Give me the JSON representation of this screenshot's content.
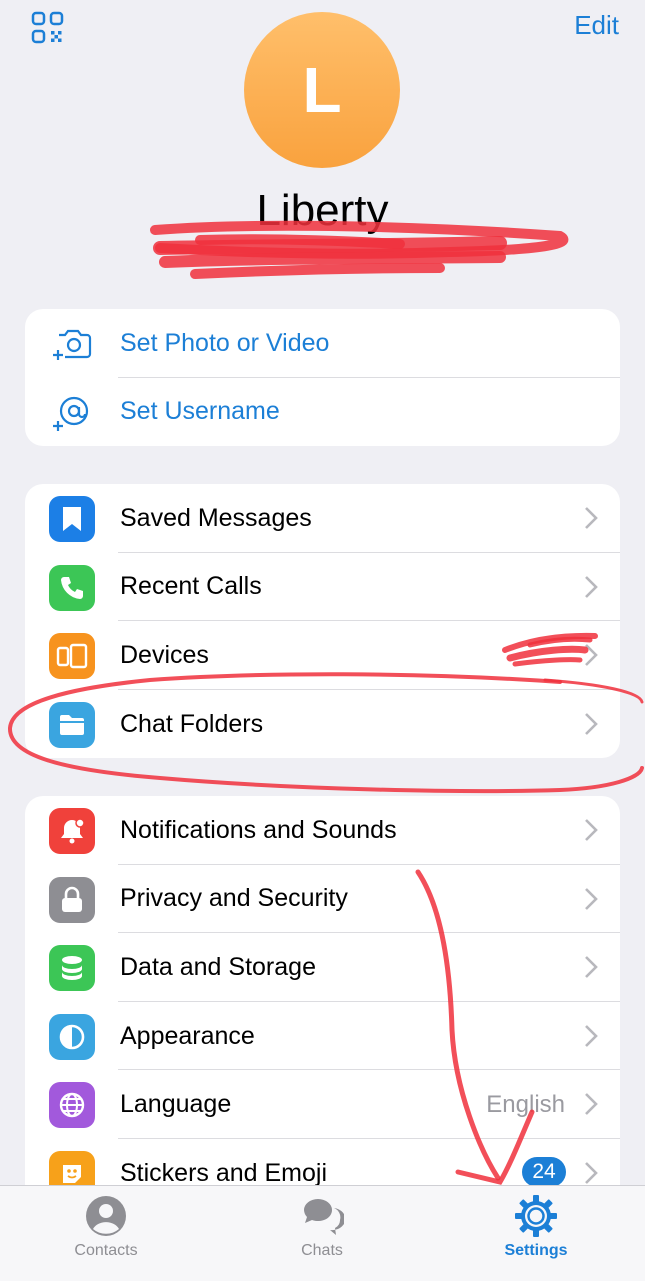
{
  "header": {
    "edit_label": "Edit",
    "qr_icon": "qr-code-icon"
  },
  "profile": {
    "initial": "L",
    "name": "Liberty",
    "avatar_color": "#f9a23e"
  },
  "account_actions": [
    {
      "label": "Set Photo or Video",
      "icon": "camera-add-icon"
    },
    {
      "label": "Set Username",
      "icon": "at-add-icon"
    }
  ],
  "group1": [
    {
      "label": "Saved Messages",
      "icon": "bookmark-icon",
      "color": "#1c7fe6"
    },
    {
      "label": "Recent Calls",
      "icon": "phone-icon",
      "color": "#3cc656"
    },
    {
      "label": "Devices",
      "icon": "devices-icon",
      "color": "#f7931e"
    },
    {
      "label": "Chat Folders",
      "icon": "folder-icon",
      "color": "#3aa5e0"
    }
  ],
  "group2": [
    {
      "label": "Notifications and Sounds",
      "icon": "bell-icon",
      "color": "#f0413b"
    },
    {
      "label": "Privacy and Security",
      "icon": "lock-icon",
      "color": "#8e8e93"
    },
    {
      "label": "Data and Storage",
      "icon": "database-icon",
      "color": "#3cc656"
    },
    {
      "label": "Appearance",
      "icon": "appearance-icon",
      "color": "#3aa5e0"
    },
    {
      "label": "Language",
      "icon": "globe-icon",
      "color": "#a259dc",
      "value": "English"
    },
    {
      "label": "Stickers and Emoji",
      "icon": "sticker-icon",
      "color": "#f7a11a",
      "badge": "24"
    }
  ],
  "tabbar": {
    "items": [
      {
        "label": "Contacts",
        "icon": "person-icon"
      },
      {
        "label": "Chats",
        "icon": "chat-bubbles-icon"
      },
      {
        "label": "Settings",
        "icon": "gear-icon"
      }
    ],
    "active": "Settings"
  },
  "colors": {
    "accent": "#1c7fd6",
    "background": "#efeff4",
    "annotation": "#f0303c"
  }
}
